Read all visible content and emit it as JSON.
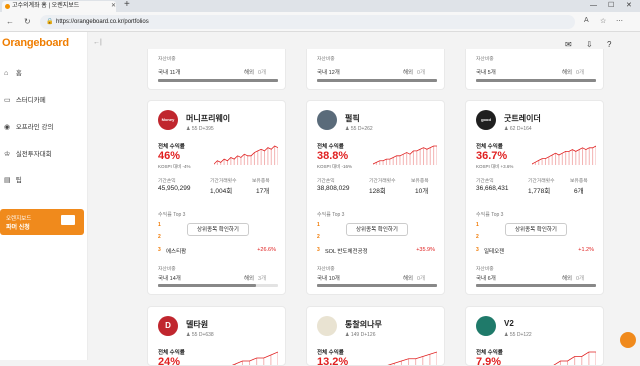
{
  "browser": {
    "tab_title": "고수의계좌 홈 | 오렌지보드",
    "url": "https://orangeboard.co.kr/portfolios"
  },
  "app": {
    "logo": "Orangeboard",
    "accent": "#ef7d00"
  },
  "sidebar": {
    "items": [
      {
        "icon": "home-icon",
        "label": "홈"
      },
      {
        "icon": "cafe-icon",
        "label": "스터디카페"
      },
      {
        "icon": "online-lecture-icon",
        "label": "오프라인 강의"
      },
      {
        "icon": "trophy-icon",
        "label": "실전투자대회"
      },
      {
        "icon": "tip-icon",
        "label": "팁"
      }
    ],
    "promo": {
      "line1": "오렌지보드",
      "line2": "파머 신청"
    }
  },
  "labels": {
    "asset_ratio": "자산비중",
    "total_return": "전체 수익률",
    "period_return": "기간손익",
    "period_trades": "기간거래횟수",
    "holdings": "보유종목",
    "top3": "수익률 Top 3",
    "confirm": "상위종목 확인하기",
    "overseas": "해외"
  },
  "top_strip": [
    {
      "domestic": "국내 11개",
      "overseas_count": "0개",
      "fill": 1.0
    },
    {
      "domestic": "국내 12개",
      "overseas_count": "0개",
      "fill": 1.0
    },
    {
      "domestic": "국내 5개",
      "overseas_count": "0개",
      "fill": 1.0
    }
  ],
  "cards": [
    {
      "name": "머니프리웨이",
      "followers": "55",
      "days": "D+395",
      "avatar_color": "#c0262e",
      "avatar_text": "Money",
      "return_pct": "46%",
      "kospi": "KOSPI 대비 -4%",
      "period_return": "45,950,299",
      "trades": "1,004회",
      "holdings": "17개",
      "top3_stock": "에스티팜",
      "top3_pct": "+26.6%",
      "domestic": "국내 14개",
      "overseas_count": "3개",
      "fill": 0.82,
      "spark": [
        4,
        6,
        5,
        7,
        6,
        8,
        7,
        9,
        8,
        10,
        9,
        9,
        11,
        12,
        13,
        12,
        14,
        13,
        15,
        14
      ]
    },
    {
      "name": "펄픽",
      "followers": "55",
      "days": "D+262",
      "avatar_color": "#5a6b7a",
      "avatar_text": "",
      "return_pct": "38.8%",
      "kospi": "KOSPI 대비 -16%",
      "period_return": "38,808,029",
      "trades": "128회",
      "holdings": "10개",
      "top3_stock": "SOL 반도체전공정",
      "top3_pct": "+35.9%",
      "domestic": "국내 10개",
      "overseas_count": "0개",
      "fill": 1.0,
      "spark": [
        3,
        4,
        5,
        5,
        6,
        6,
        7,
        8,
        8,
        9,
        10,
        9,
        11,
        11,
        12,
        13,
        12,
        13,
        14,
        14
      ]
    },
    {
      "name": "굿트레이더",
      "followers": "62",
      "days": "D+164",
      "avatar_color": "#1f1f1f",
      "avatar_text": "good",
      "return_pct": "36.7%",
      "kospi": "KOSPI 대비 +3.6%",
      "period_return": "36,668,431",
      "trades": "1,778회",
      "holdings": "6개",
      "top3_stock": "일테오젠",
      "top3_pct": "+1.2%",
      "domestic": "국내 6개",
      "overseas_count": "0개",
      "fill": 1.0,
      "spark": [
        5,
        6,
        7,
        8,
        8,
        9,
        10,
        11,
        10,
        11,
        12,
        12,
        13,
        12,
        13,
        14,
        13,
        14,
        14,
        15
      ]
    },
    {
      "name": "델타원",
      "followers": "55",
      "days": "D+638",
      "avatar_color": "#c0262e",
      "avatar_text": "D",
      "return_pct": "24%",
      "spark": [
        5,
        6,
        6,
        7,
        8,
        8,
        9,
        9,
        10,
        11
      ]
    },
    {
      "name": "통찰의나무",
      "followers": "149",
      "days": "D+126",
      "avatar_color": "#e9e3d2",
      "avatar_text": "",
      "return_pct": "13.2%",
      "spark": [
        4,
        5,
        6,
        7,
        8,
        9,
        9,
        10,
        11,
        12
      ]
    },
    {
      "name": "V2",
      "followers": "55",
      "days": "D+122",
      "avatar_color": "#1f7a6a",
      "avatar_text": "",
      "return_pct": "7.9%",
      "spark": [
        6,
        6,
        7,
        7,
        8,
        8,
        9,
        9,
        10,
        10
      ]
    }
  ]
}
